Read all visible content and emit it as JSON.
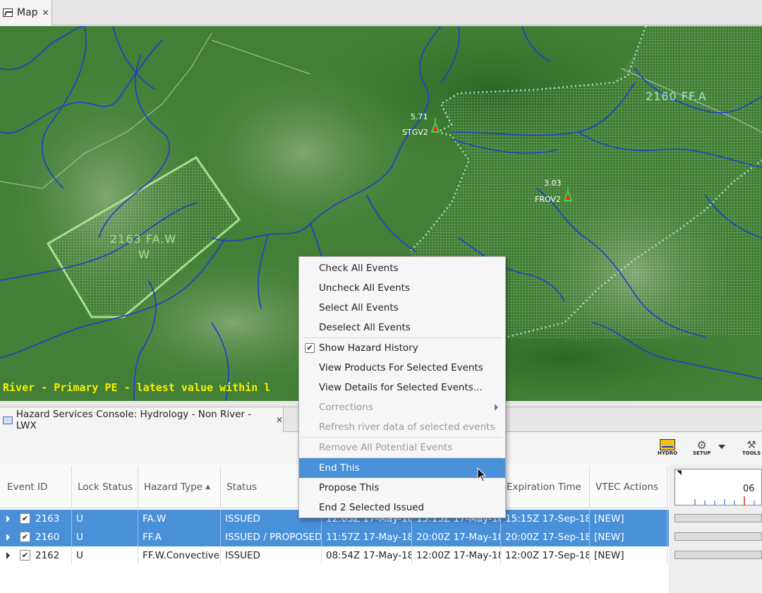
{
  "map_tab": {
    "title": "Map",
    "close": "✕"
  },
  "map": {
    "legend_text": "River - Primary PE - latest value within l",
    "hazards": [
      {
        "label": "2163 FA.W",
        "label2": "W",
        "color": "#a8e08a"
      },
      {
        "label": "2160 FF.A",
        "color": "#9fe8d2"
      }
    ],
    "gauges": [
      {
        "value": "5.71",
        "id": "STGV2"
      },
      {
        "value": "3.03",
        "id": "FROV2"
      }
    ]
  },
  "console_tab": {
    "title": "Hazard Services Console: Hydrology - Non River - LWX",
    "close": "✕"
  },
  "toolbar": {
    "hydro_label": "HYDRO",
    "setup_label": "SETUP",
    "tools_label": "TOOLS"
  },
  "table": {
    "columns": [
      "Event ID",
      "Lock Status",
      "Hazard Type",
      "Status",
      "",
      "",
      "Expiration Time",
      "VTEC Actions"
    ],
    "sort_indicator": "▲",
    "rows": [
      {
        "event_id": "2163",
        "lock": "U",
        "hazard": "FA.W",
        "status": "ISSUED",
        "start": "12:03Z 17-May-18",
        "end": "15:15Z 17-May-18",
        "expiration": "15:15Z 17-Sep-18",
        "vtec": "[NEW]",
        "checked": "✔"
      },
      {
        "event_id": "2160",
        "lock": "U",
        "hazard": "FF.A",
        "status": "ISSUED / PROPOSED",
        "start": "11:57Z 17-May-18",
        "end": "20:00Z 17-May-18",
        "expiration": "20:00Z 17-Sep-18",
        "vtec": "[NEW]",
        "checked": "✔"
      },
      {
        "event_id": "2162",
        "lock": "U",
        "hazard": "FF.W.Convective",
        "status": "ISSUED",
        "start": "08:54Z 17-May-18",
        "end": "12:00Z 17-May-18",
        "expiration": "12:00Z 17-Sep-18",
        "vtec": "[NEW]",
        "checked": "✔"
      }
    ]
  },
  "timeline": {
    "hour_label": "06"
  },
  "context_menu": {
    "items": [
      {
        "label": "Check All Events"
      },
      {
        "label": "Uncheck All Events"
      },
      {
        "label": "Select All Events"
      },
      {
        "label": "Deselect All Events"
      },
      {
        "label": "Show Hazard History",
        "check": "✔"
      },
      {
        "label": "View Products For Selected Events"
      },
      {
        "label": "View Details for Selected Events..."
      },
      {
        "label": "Corrections"
      },
      {
        "label": "Refresh river data of selected events"
      },
      {
        "label": "Remove All Potential Events"
      },
      {
        "label": "End This"
      },
      {
        "label": "Propose This"
      },
      {
        "label": "End 2 Selected Issued"
      }
    ]
  }
}
